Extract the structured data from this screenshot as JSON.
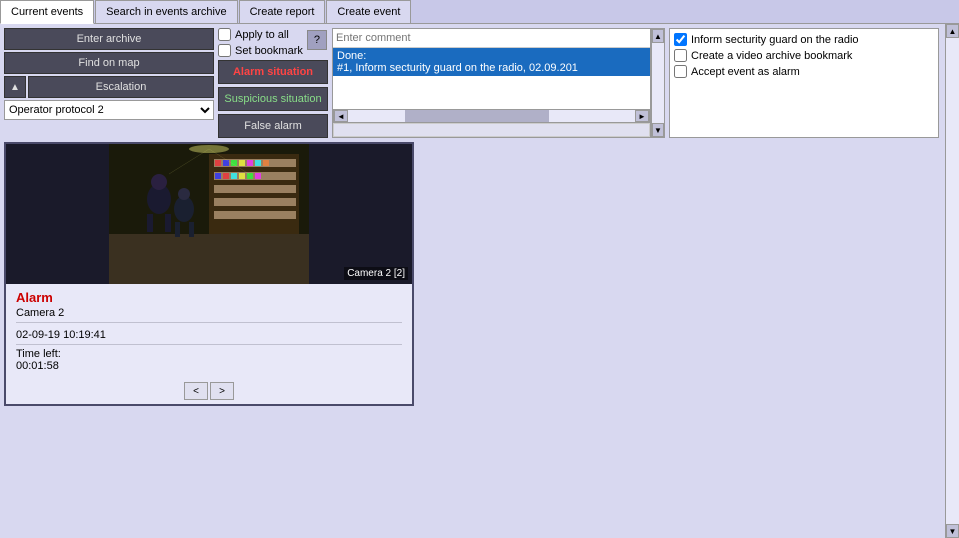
{
  "tabs": [
    {
      "id": "current-events",
      "label": "Current events",
      "active": true
    },
    {
      "id": "search-archive",
      "label": "Search in events archive",
      "active": false
    },
    {
      "id": "create-report",
      "label": "Create report",
      "active": false
    },
    {
      "id": "create-event",
      "label": "Create event",
      "active": false
    }
  ],
  "left_panel": {
    "enter_archive_label": "Enter archive",
    "find_on_map_label": "Find on map",
    "escalation_label": "Escalation",
    "protocol_label": "Operator protocol 2"
  },
  "checkboxes": {
    "apply_to_all": "Apply to all",
    "set_bookmark": "Set bookmark"
  },
  "help_button": "?",
  "action_buttons": {
    "alarm": "Alarm situation",
    "suspicious": "Suspicious situation",
    "false_alarm": "False alarm"
  },
  "comment": {
    "placeholder": "Enter comment",
    "done_label": "Done:",
    "done_text": "#1, Inform secturity guard on the radio, 02.09.201"
  },
  "right_checks": {
    "items": [
      {
        "label": "Inform secturity guard on the radio",
        "checked": true
      },
      {
        "label": "Create a video archive bookmark",
        "checked": false
      },
      {
        "label": "Accept event as alarm",
        "checked": false
      }
    ]
  },
  "camera_card": {
    "alarm_label": "Alarm",
    "camera_name": "Camera 2",
    "datetime": "02-09-19 10:19:41",
    "time_left_label": "Time left:",
    "time_left_value": "00:01:58",
    "camera_label": "Camera 2 [2]",
    "nav_prev": "<",
    "nav_next": ">"
  },
  "scrollbar": {
    "up": "▲",
    "down": "▼",
    "left": "◄",
    "right": "►"
  }
}
